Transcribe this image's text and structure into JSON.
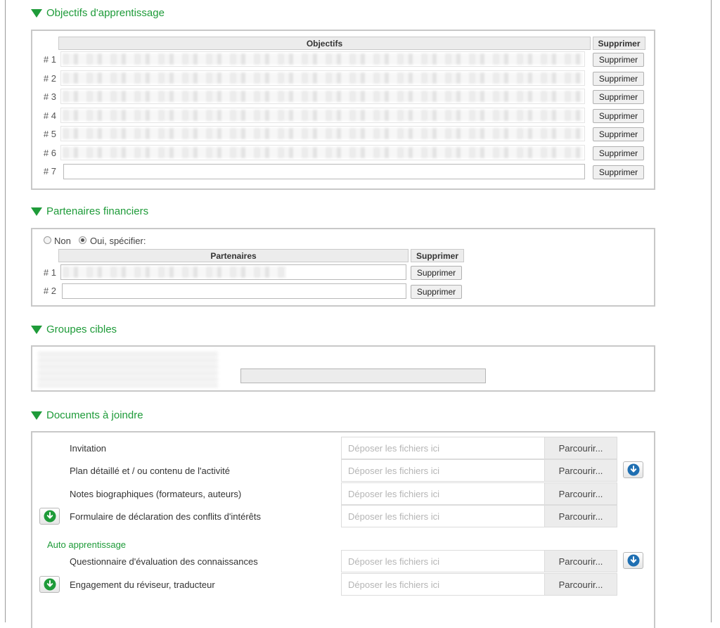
{
  "sections": {
    "objectifs": {
      "title": "Objectifs d'apprentissage"
    },
    "partenaires": {
      "title": "Partenaires financiers"
    },
    "groupes": {
      "title": "Groupes cibles"
    },
    "documents": {
      "title": "Documents à joindre"
    }
  },
  "objectifs_table": {
    "col_header": "Objectifs",
    "delete_header": "Supprimer",
    "rows": [
      {
        "num": "# 1",
        "value": "",
        "delete_label": "Supprimer"
      },
      {
        "num": "# 2",
        "value": "",
        "delete_label": "Supprimer"
      },
      {
        "num": "# 3",
        "value": "",
        "delete_label": "Supprimer"
      },
      {
        "num": "# 4",
        "value": "",
        "delete_label": "Supprimer"
      },
      {
        "num": "# 5",
        "value": "",
        "delete_label": "Supprimer"
      },
      {
        "num": "# 6",
        "value": "",
        "delete_label": "Supprimer"
      },
      {
        "num": "# 7",
        "value": "",
        "delete_label": "Supprimer"
      }
    ]
  },
  "partenaires_panel": {
    "radio_non": "Non",
    "radio_oui": "Oui, spécifier:",
    "selected": "oui",
    "col_header": "Partenaires",
    "delete_header": "Supprimer",
    "rows": [
      {
        "num": "# 1",
        "value": "",
        "delete_label": "Supprimer"
      },
      {
        "num": "# 2",
        "value": "",
        "delete_label": "Supprimer"
      }
    ]
  },
  "documents": {
    "dropzone_placeholder": "Déposer les fichiers ici",
    "browse_label": "Parcourir...",
    "items": [
      {
        "label": "Invitation"
      },
      {
        "label": "Plan détaillé et / ou contenu de l'activité"
      },
      {
        "label": "Notes biographiques (formateurs, auteurs)"
      },
      {
        "label": "Formulaire de déclaration des conflits d'intérêts"
      }
    ],
    "auto_header": "Auto apprentissage",
    "auto_items": [
      {
        "label": "Questionnaire d'évaluation des connaissances"
      },
      {
        "label": "Engagement du réviseur, traducteur"
      }
    ]
  },
  "colors": {
    "accent_green": "#1e9b39",
    "download_green": "#1e9b39",
    "download_blue": "#1f6fb2"
  },
  "icons": {
    "section_toggle": "triangle-down-icon",
    "download_green": "download-circle-icon",
    "download_blue": "download-circle-icon"
  }
}
